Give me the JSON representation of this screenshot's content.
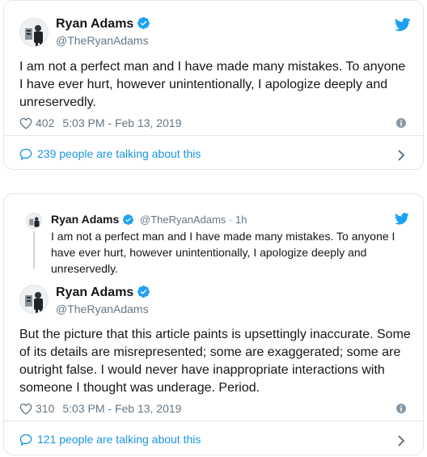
{
  "colors": {
    "accent": "#1da1f2",
    "link": "#1b95e0",
    "muted": "#657786",
    "border": "#e1e8ed"
  },
  "tweet1": {
    "name": "Ryan Adams",
    "handle": "@TheRyanAdams",
    "text": "I am not a perfect man and I have made many mistakes. To anyone I have ever hurt, however unintentionally, I apologize deeply and unreservedly.",
    "likes": "402",
    "timestamp": "5:03 PM - Feb 13, 2019",
    "talking": "239 people are talking about this",
    "icons": [
      "twitter-bird-icon",
      "verified-badge-icon",
      "heart-icon",
      "info-icon",
      "speech-bubble-icon",
      "chevron-right-icon"
    ]
  },
  "tweet2": {
    "parent": {
      "name": "Ryan Adams",
      "handle": "@TheRyanAdams",
      "separator": "·",
      "age": "1h",
      "text": "I am not a perfect man and I have made many mistakes. To anyone I have ever hurt, however unintentionally, I apologize deeply and unreservedly."
    },
    "name": "Ryan Adams",
    "handle": "@TheRyanAdams",
    "text": "But the picture that this article paints is upsettingly inaccurate. Some of its details are misrepresented; some are exaggerated; some are outright false. I would never have inappropriate interactions with someone I thought was underage. Period.",
    "likes": "310",
    "timestamp": "5:03 PM - Feb 13, 2019",
    "talking": "121 people are talking about this"
  }
}
